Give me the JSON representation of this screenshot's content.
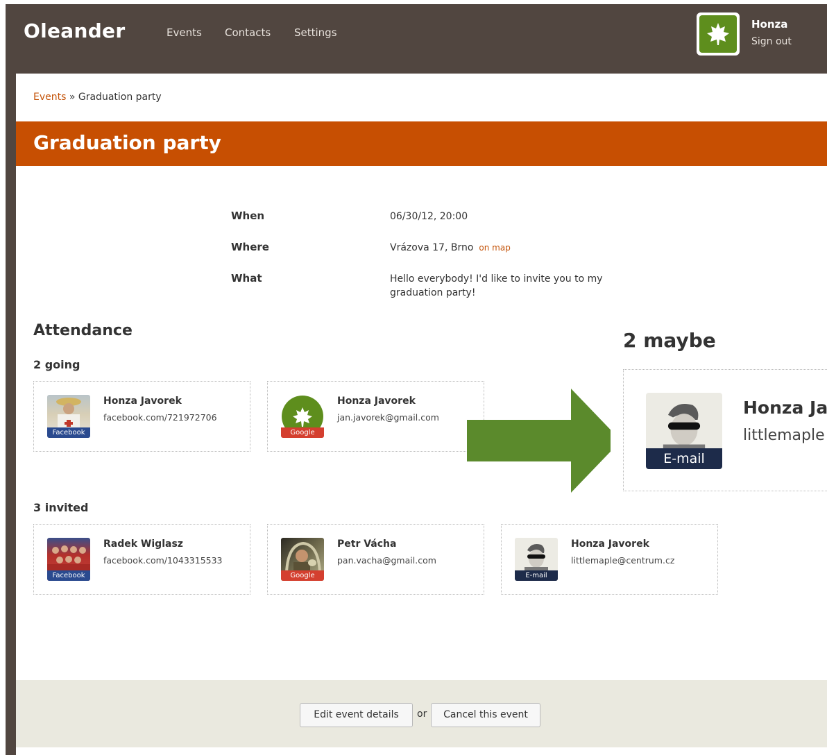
{
  "app": {
    "title": "Oleander"
  },
  "nav": {
    "items": [
      "Events",
      "Contacts",
      "Settings"
    ]
  },
  "user": {
    "name": "Honza",
    "sign_out": "Sign out"
  },
  "breadcrumb": {
    "link": "Events",
    "separator": " » ",
    "current": "Graduation party"
  },
  "event": {
    "title": "Graduation party",
    "details": [
      {
        "label": "When",
        "value": "06/30/12, 20:00"
      },
      {
        "label": "Where",
        "value": "Vrázova 17, Brno",
        "link": "on map"
      },
      {
        "label": "What",
        "value": "Hello everybody! I'd like to invite you to my graduation party!"
      }
    ]
  },
  "attendance": {
    "heading": "Attendance",
    "going": {
      "heading": "2 going",
      "people": [
        {
          "name": "Honza Javorek",
          "contact": "facebook.com/721972706",
          "source": "Facebook"
        },
        {
          "name": "Honza Javorek",
          "contact": "jan.javorek@gmail.com",
          "source": "Google"
        }
      ]
    },
    "invited": {
      "heading": "3 invited",
      "people": [
        {
          "name": "Radek Wiglasz",
          "contact": "facebook.com/1043315533",
          "source": "Facebook"
        },
        {
          "name": "Petr Vácha",
          "contact": "pan.vacha@gmail.com",
          "source": "Google"
        },
        {
          "name": "Honza Javorek",
          "contact": "littlemaple@centrum.cz",
          "source": "E-mail"
        }
      ]
    },
    "maybe": {
      "heading": "2 maybe",
      "person": {
        "name": "Honza Ja",
        "contact": "littlemaple",
        "source": "E-mail"
      }
    }
  },
  "footer": {
    "edit_label": "Edit event details",
    "or": "or",
    "cancel_label": "Cancel this event"
  },
  "colors": {
    "brand": "#c74f02",
    "header_bg": "#514640",
    "facebook": "#2a4a8f",
    "google": "#d43f2f",
    "email": "#1d2b4a",
    "arrow": "#5b8a2c",
    "footer_bg": "#eae9df"
  }
}
